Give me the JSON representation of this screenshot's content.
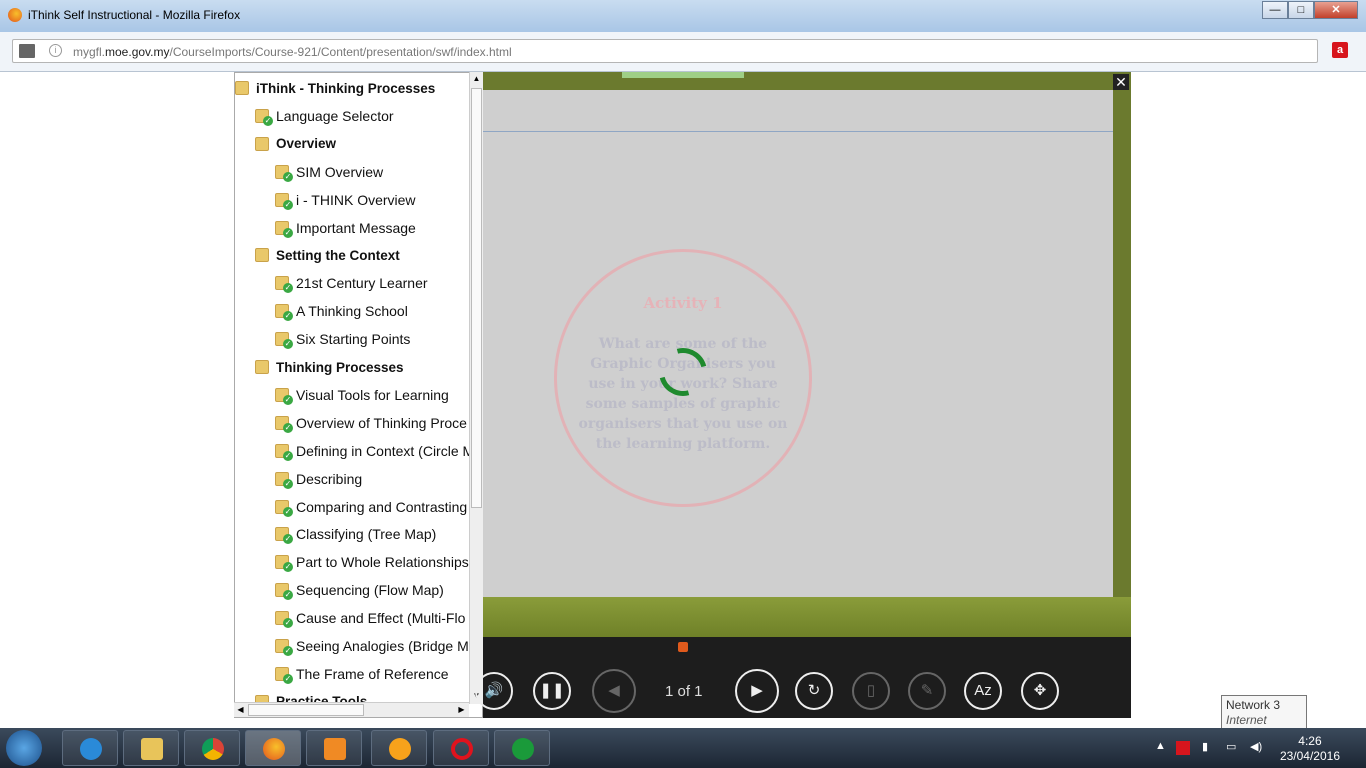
{
  "window": {
    "title": "iThink Self Instructional - Mozilla Firefox",
    "min": "—",
    "max": "□",
    "close": "✕"
  },
  "address": {
    "prefix": "mygfl.",
    "domain": "moe.gov.my",
    "path": "/CourseImports/Course-921/Content/presentation/swf/index.html"
  },
  "tree": {
    "items": [
      {
        "label": "iThink - Thinking Processes",
        "level": 0,
        "bold": true,
        "check": false
      },
      {
        "label": "Language Selector",
        "level": 1,
        "bold": false,
        "check": true
      },
      {
        "label": "Overview",
        "level": 1,
        "bold": true,
        "check": false
      },
      {
        "label": "SIM Overview",
        "level": 2,
        "bold": false,
        "check": true
      },
      {
        "label": "i - THINK Overview",
        "level": 2,
        "bold": false,
        "check": true
      },
      {
        "label": "Important Message",
        "level": 2,
        "bold": false,
        "check": true
      },
      {
        "label": "Setting the Context",
        "level": 1,
        "bold": true,
        "check": false
      },
      {
        "label": "21st Century Learner",
        "level": 2,
        "bold": false,
        "check": true
      },
      {
        "label": "A Thinking School",
        "level": 2,
        "bold": false,
        "check": true
      },
      {
        "label": "Six Starting Points",
        "level": 2,
        "bold": false,
        "check": true
      },
      {
        "label": "Thinking Processes",
        "level": 1,
        "bold": true,
        "check": false
      },
      {
        "label": "Visual Tools for Learning",
        "level": 2,
        "bold": false,
        "check": true
      },
      {
        "label": "Overview of Thinking Proce",
        "level": 2,
        "bold": false,
        "check": true
      },
      {
        "label": "Defining in Context (Circle M",
        "level": 2,
        "bold": false,
        "check": true
      },
      {
        "label": "Describing",
        "level": 2,
        "bold": false,
        "check": true
      },
      {
        "label": "Comparing and Contrasting",
        "level": 2,
        "bold": false,
        "check": true
      },
      {
        "label": "Classifying (Tree Map)",
        "level": 2,
        "bold": false,
        "check": true
      },
      {
        "label": "Part to Whole Relationships",
        "level": 2,
        "bold": false,
        "check": true
      },
      {
        "label": "Sequencing (Flow Map)",
        "level": 2,
        "bold": false,
        "check": true
      },
      {
        "label": "Cause and Effect (Multi-Flo",
        "level": 2,
        "bold": false,
        "check": true
      },
      {
        "label": "Seeing Analogies (Bridge M",
        "level": 2,
        "bold": false,
        "check": true
      },
      {
        "label": "The Frame of Reference",
        "level": 2,
        "bold": false,
        "check": true
      },
      {
        "label": "Practice Tools",
        "level": 1,
        "bold": true,
        "check": false
      }
    ]
  },
  "slide": {
    "heading": "Activity 1",
    "text": "What are some of the Graphic Organisers you use in your work? Share some samples of graphic organisers that you use on the learning platform."
  },
  "player": {
    "close": "✕",
    "page": "1 of 1",
    "buttons": [
      {
        "name": "volume",
        "glyph": "🔊",
        "dim": false
      },
      {
        "name": "pause",
        "glyph": "❚❚",
        "dim": false
      },
      {
        "name": "previous",
        "glyph": "◀",
        "dim": true
      },
      {
        "name": "next",
        "glyph": "▶",
        "dim": false
      },
      {
        "name": "replay",
        "glyph": "↻",
        "dim": false
      },
      {
        "name": "notes",
        "glyph": "▯",
        "dim": true
      },
      {
        "name": "resources",
        "glyph": "✎",
        "dim": true
      },
      {
        "name": "glossary",
        "glyph": "Az",
        "dim": false
      },
      {
        "name": "fullscreen",
        "glyph": "✥",
        "dim": false
      }
    ],
    "accent": "#e05a1c"
  },
  "tooltip": {
    "title": "Network  3",
    "sub": "Internet access"
  },
  "clock": {
    "time": "4:26",
    "date": "23/04/2016"
  }
}
